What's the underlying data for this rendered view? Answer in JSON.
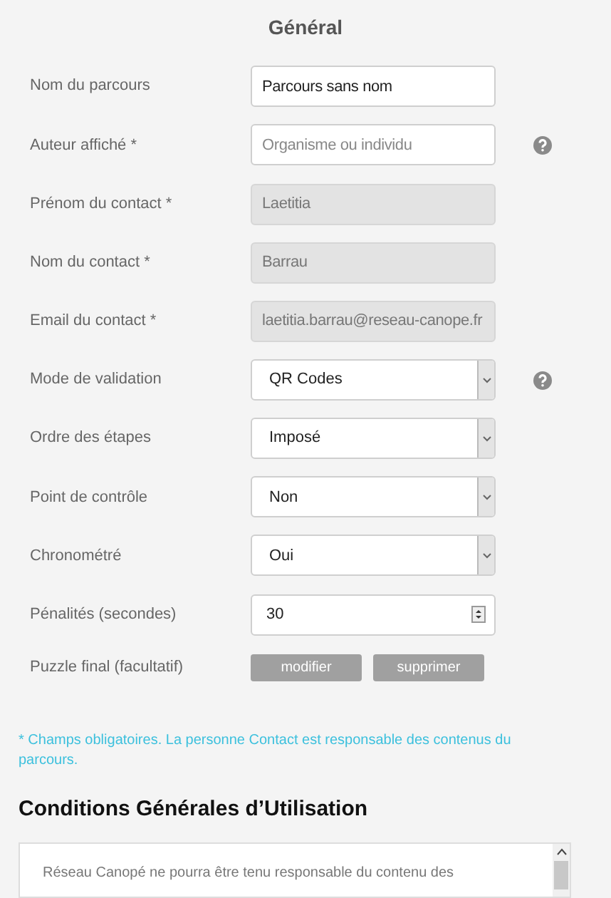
{
  "title": "Général",
  "fields": [
    {
      "label": "Nom du parcours",
      "kind": "text",
      "value": "Parcours sans nom",
      "help": false
    },
    {
      "label": "Auteur affiché *",
      "kind": "text",
      "placeholder": "Organisme ou individu",
      "help": true
    },
    {
      "label": "Prénom du contact *",
      "kind": "text",
      "value": "Laetitia",
      "disabled": true,
      "help": false
    },
    {
      "label": "Nom du contact *",
      "kind": "text",
      "value": "Barrau",
      "disabled": true,
      "help": false
    },
    {
      "label": "Email du contact *",
      "kind": "text",
      "value": "laetitia.barrau@reseau-canope.fr",
      "disabled": true,
      "help": false
    },
    {
      "label": "Mode de validation",
      "kind": "select",
      "value": "QR Codes",
      "help": true
    },
    {
      "label": "Ordre des étapes",
      "kind": "select",
      "value": "Imposé",
      "help": false
    },
    {
      "label": "Point de contrôle",
      "kind": "select",
      "value": "Non",
      "help": false
    },
    {
      "label": "Chronométré",
      "kind": "select",
      "value": "Oui",
      "help": false
    },
    {
      "label": "Pénalités (secondes)",
      "kind": "number",
      "value": "30",
      "help": false
    }
  ],
  "puzzle": {
    "label": "Puzzle final (facultatif)",
    "buttons": [
      "modifier",
      "supprimer"
    ]
  },
  "note": "* Champs obligatoires. La personne Contact est responsable des contenus du parcours.",
  "terms": {
    "heading": "Conditions Générales d’Utilisation",
    "text": "Réseau Canopé ne pourra être tenu responsable du contenu des"
  }
}
